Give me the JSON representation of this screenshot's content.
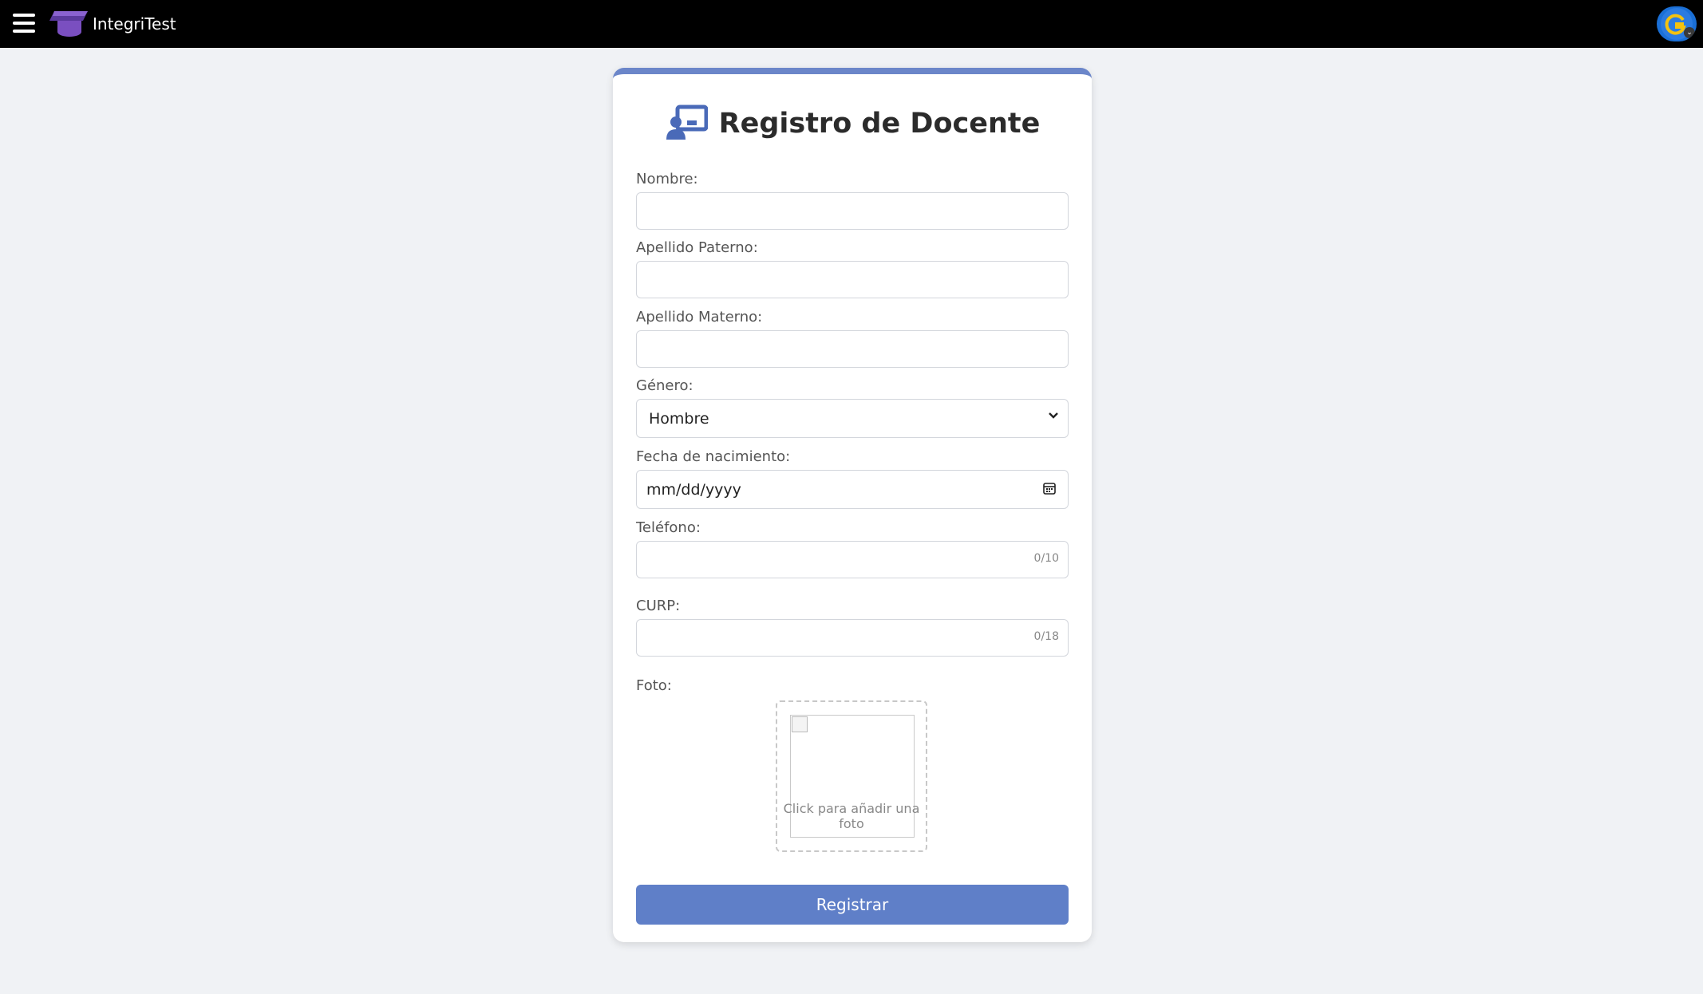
{
  "app": {
    "name": "IntegriTest"
  },
  "header": {
    "menu_icon": "hamburger-menu-icon",
    "logo_icon": "graduation-cap-icon",
    "avatar_icon": "google-avatar-icon"
  },
  "form": {
    "title": "Registro de Docente",
    "title_icon": "teacher-board-icon",
    "accent_color": "#6b86c9",
    "fields": {
      "nombre_label": "Nombre:",
      "apellido_paterno_label": "Apellido Paterno:",
      "apellido_materno_label": "Apellido Materno:",
      "genero_label": "Género:",
      "genero_value": "Hombre",
      "fecha_label": "Fecha de nacimiento:",
      "fecha_placeholder": "mm/dd/yyyy",
      "telefono_label": "Teléfono:",
      "telefono_counter": "0/10",
      "curp_label": "CURP:",
      "curp_counter": "0/18",
      "foto_label": "Foto:",
      "foto_hint": "Click para añadir una foto"
    },
    "submit_label": "Registrar",
    "submit_color": "#5f7fc8"
  }
}
